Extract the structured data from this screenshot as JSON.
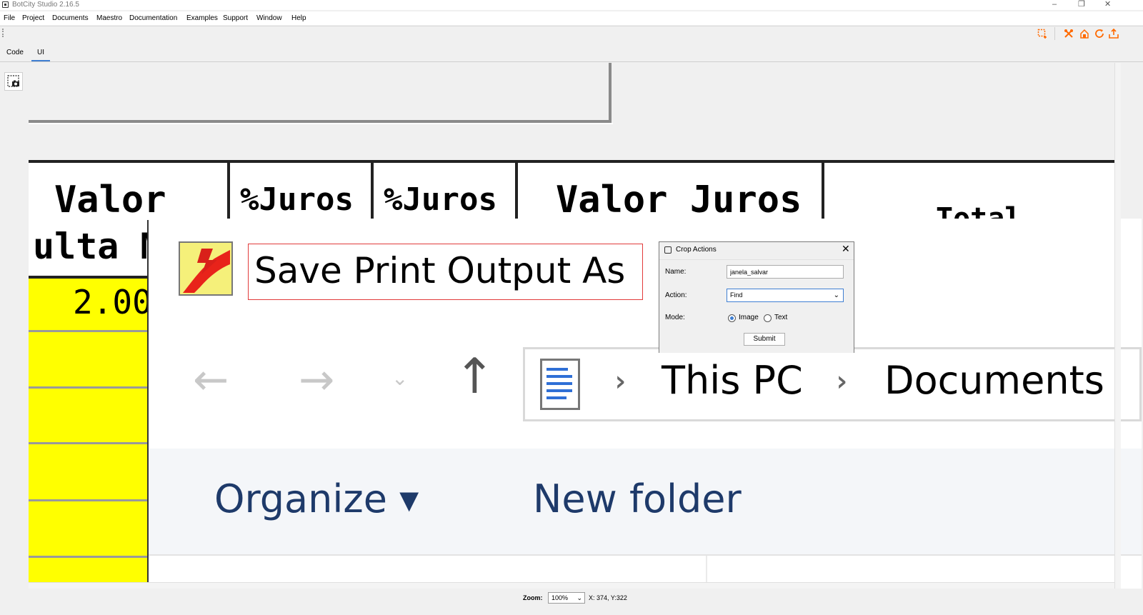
{
  "window": {
    "title": "BotCity Studio 2.16.5",
    "controls": {
      "minimize": "–",
      "restore": "❐",
      "close": "✕"
    }
  },
  "menu": {
    "items": [
      "File",
      "Project",
      "Documents",
      "Maestro",
      "Documentation",
      "Examples",
      "Support",
      "Window",
      "Help"
    ]
  },
  "toolbar": {
    "icons": [
      "crop-select-icon",
      "tools-icon",
      "deploy-icon",
      "refresh-icon",
      "upload-icon"
    ],
    "accent": "#ff6a00"
  },
  "tabs": [
    {
      "label": "Code",
      "active": false
    },
    {
      "label": "UI",
      "active": true
    }
  ],
  "left_tools": {
    "capture_icon": "screen-capture-icon"
  },
  "screenshot": {
    "table_headers": [
      "Valor",
      "%Juros",
      "%Juros",
      "Valor Juros",
      "Total"
    ],
    "row_label": "ulta M",
    "row_value": "2.00",
    "highlight_color": "#ffff00",
    "dialog": {
      "title": "Save Print Output As",
      "breadcrumb": [
        "This PC",
        "Documents"
      ],
      "toolbar": {
        "organize": "Organize ▾",
        "new_folder": "New folder"
      }
    }
  },
  "crop_actions": {
    "title": "Crop Actions",
    "name_label": "Name:",
    "name_value": "janela_salvar",
    "action_label": "Action:",
    "action_value": "Find",
    "mode_label": "Mode:",
    "mode_options": [
      {
        "label": "Image",
        "selected": true
      },
      {
        "label": "Text",
        "selected": false
      }
    ],
    "submit_label": "Submit"
  },
  "status": {
    "zoom_label": "Zoom:",
    "zoom_value": "100%",
    "coords": "X: 374, Y:322"
  }
}
